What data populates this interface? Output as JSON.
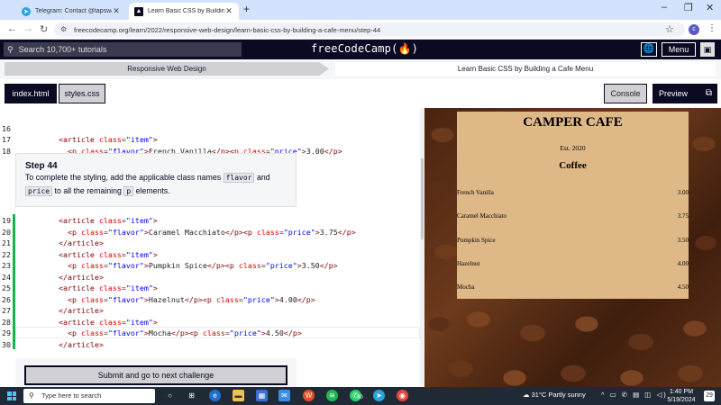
{
  "browser": {
    "tabs": [
      {
        "title": "Telegram: Contact @tapswap_mi...",
        "icon": "telegram-icon"
      },
      {
        "title": "Learn Basic CSS by Building a Ca...",
        "icon": "fcc-icon"
      }
    ],
    "url": "freecodecamp.org/learn/2022/responsive-web-design/learn-basic-css-by-building-a-cafe-menu/step-44",
    "profile_initial": "c"
  },
  "fcc": {
    "search_placeholder": "Search 10,700+ tutorials",
    "brand": "freeCodeCamp(🔥)",
    "menu_label": "Menu"
  },
  "breadcrumbs": {
    "superblock": "Responsive Web Design",
    "block": "Learn Basic CSS by Building a Cafe Menu"
  },
  "editor_tabs": {
    "file1": "index.html",
    "file2": "styles.css",
    "console": "Console",
    "preview": "Preview"
  },
  "code_top": [
    {
      "n": "16",
      "indent": "        ",
      "kind": "open",
      "cls": "item"
    },
    {
      "n": "17",
      "indent": "          ",
      "kind": "p",
      "flavor": "French Vanilla",
      "price": "3.00"
    },
    {
      "n": "18",
      "indent": "        ",
      "kind": "close"
    }
  ],
  "step": {
    "title": "Step 44",
    "text_before": "To complete the styling, add the applicable class names",
    "code1": "flavor",
    "text_and": "and",
    "code2": "price",
    "text_mid": "to all the remaining",
    "code3": "p",
    "text_after": "elements."
  },
  "code_bottom": [
    {
      "n": "19",
      "text": "        <article class=\"item\">"
    },
    {
      "n": "20",
      "text": "          <p class=\"flavor\">Caramel Macchiato</p><p class=\"price\">3.75</p>"
    },
    {
      "n": "21",
      "text": "        </article>"
    },
    {
      "n": "22",
      "text": "        <article class=\"item\">"
    },
    {
      "n": "23",
      "text": "          <p class=\"flavor\">Pumpkin Spice</p><p class=\"price\">3.50</p>"
    },
    {
      "n": "24",
      "text": "        </article>"
    },
    {
      "n": "25",
      "text": "        <article class=\"item\">"
    },
    {
      "n": "26",
      "text": "          <p class=\"flavor\">Hazelnut</p><p class=\"price\">4.00</p>"
    },
    {
      "n": "27",
      "text": "        </article>"
    },
    {
      "n": "28",
      "text": "        <article class=\"item\">"
    },
    {
      "n": "29",
      "text": "          <p class=\"flavor\">Mocha</p><p class=\"price\">4.50</p>"
    },
    {
      "n": "30",
      "text": "        </article>"
    }
  ],
  "submit_label": "Submit and go to next challenge",
  "preview": {
    "title": "CAMPER CAFE",
    "est": "Est. 2020",
    "section": "Coffee",
    "items": [
      {
        "flavor": "French Vanilla",
        "price": "3.00"
      },
      {
        "flavor": "Caramel Macchiato",
        "price": "3.75"
      },
      {
        "flavor": "Pumpkin Spice",
        "price": "3.50"
      },
      {
        "flavor": "Hazelnut",
        "price": "4.00"
      },
      {
        "flavor": "Mocha",
        "price": "4.50"
      }
    ]
  },
  "taskbar": {
    "search_placeholder": "Type here to search",
    "weather": "31°C  Partly sunny",
    "time": "1:40 PM",
    "date": "5/19/2024",
    "notifications": "29",
    "whatsapp_badge": "30"
  },
  "colors": {
    "fcc_dark": "#0a0a23",
    "gutter_green": "#19b34b",
    "menu_bg": "#deb887",
    "tag": "#800000",
    "attr": "#e50000",
    "string": "#0000ff"
  }
}
